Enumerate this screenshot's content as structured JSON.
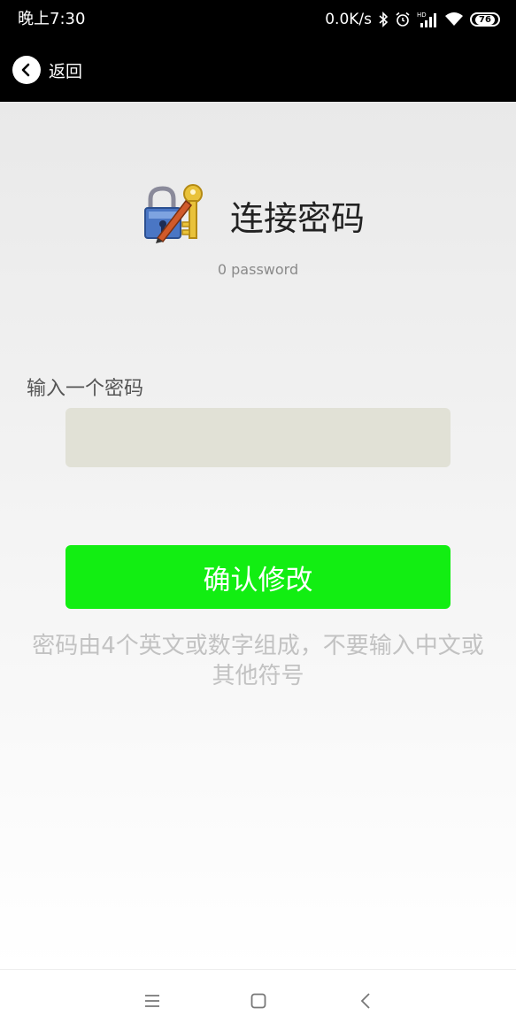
{
  "status_bar": {
    "time": "晚上7:30",
    "network_speed": "0.0K/s",
    "battery_level": "76",
    "hd_label": "HD",
    "icons": [
      "bluetooth-icon",
      "alarm-icon",
      "signal-icon",
      "wifi-icon",
      "battery-icon"
    ]
  },
  "titlebar": {
    "back_label": "返回"
  },
  "header": {
    "title": "连接密码",
    "subtitle": "0 password",
    "icon": "lock-key-icon"
  },
  "form": {
    "label": "输入一个密码",
    "input_value": "",
    "input_placeholder": "",
    "confirm_label": "确认修改",
    "hint_line1": "密码由4个英文或数字组成，不要输入中文或",
    "hint_line2": "其他符号"
  },
  "navbar": {
    "icons": [
      "menu-icon",
      "home-icon",
      "back-icon"
    ]
  },
  "colors": {
    "confirm_button": "#12ee12",
    "input_background": "#e1e1d6",
    "bars": "#000000"
  }
}
